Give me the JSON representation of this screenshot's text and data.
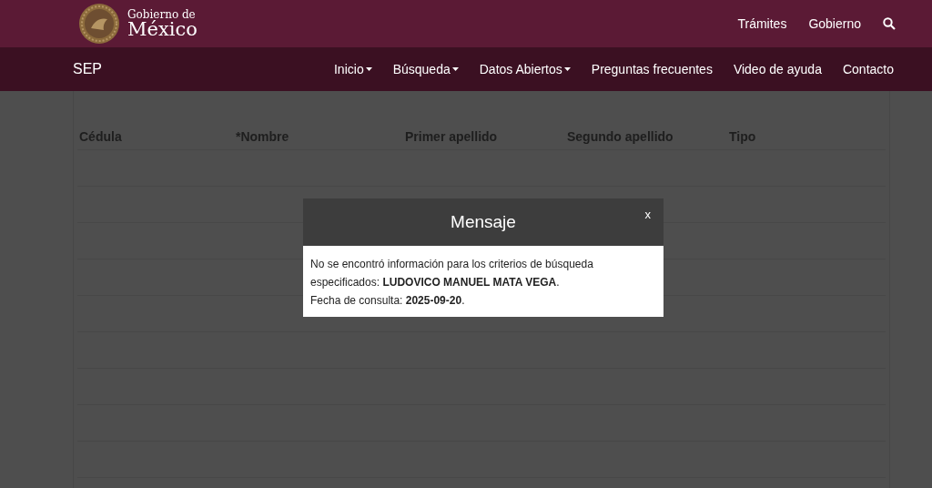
{
  "header": {
    "logo": {
      "line1": "Gobierno de",
      "line2": "México"
    },
    "links": [
      "Trámites",
      "Gobierno"
    ]
  },
  "navbar": {
    "brand": "SEP",
    "items": [
      {
        "label": "Inicio",
        "dropdown": true
      },
      {
        "label": "Búsqueda",
        "dropdown": true
      },
      {
        "label": "Datos Abiertos",
        "dropdown": true
      },
      {
        "label": "Preguntas frecuentes",
        "dropdown": false
      },
      {
        "label": "Video de ayuda",
        "dropdown": false
      },
      {
        "label": "Contacto",
        "dropdown": false
      }
    ]
  },
  "table": {
    "columns": [
      "Cédula",
      "*Nombre",
      "Primer apellido",
      "Segundo apellido",
      "Tipo"
    ]
  },
  "dialog": {
    "title": "Mensaje",
    "close": "x",
    "lines": [
      "No se encontró información para los criterios de búsqueda especificados: **LUDOVICO MANUEL MATA VEGA**.",
      "Fecha de consulta: **2025-09-20**."
    ]
  }
}
